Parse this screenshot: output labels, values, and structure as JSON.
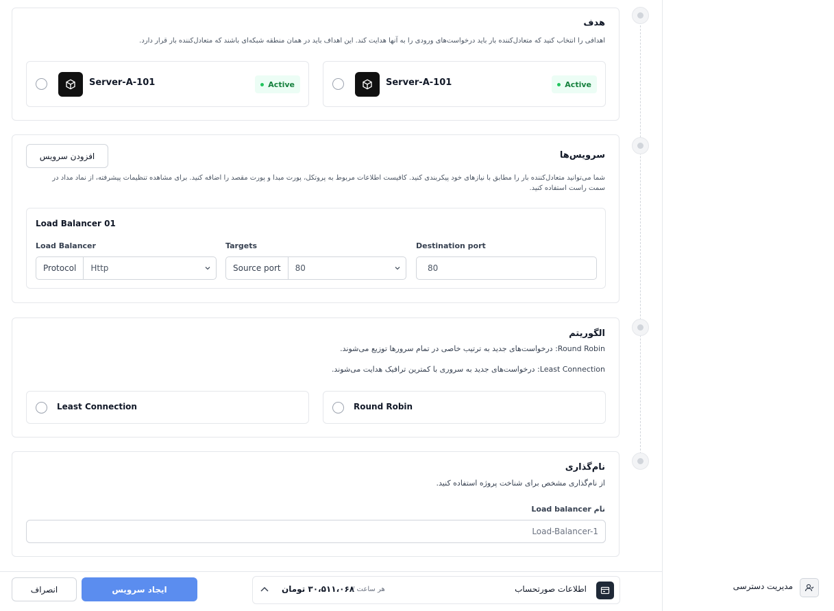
{
  "target_section": {
    "title": "هدف",
    "description": "اهدافی را انتخاب کنید که متعادل‌کننده بار باید درخواست‌های ورودی را به آنها هدایت کند. این اهداف باید در همان منطقه شبکه‌ای باشند که متعادل‌کننده بار قرار دارد.",
    "targets": [
      {
        "name": "Server-A-101",
        "status": "Active"
      },
      {
        "name": "Server-A-101",
        "status": "Active"
      }
    ]
  },
  "services_section": {
    "title": "سرویس‌ها",
    "add_button": "افزودن سرویس",
    "description": "شما می‌توانید متعادل‌کننده بار را مطابق با نیازهای خود پیکربندی کنید. کافیست اطلاعات مربوط به پروتکل، پورت مبدا و پورت مقصد را اضافه کنید. برای مشاهده تنظیمات پیشرفته، از نماد مداد در سمت راست استفاده کنید.",
    "service": {
      "title": "Load Balancer 01",
      "lb_label": "Load Balancer",
      "protocol_addon": "Protocol",
      "protocol_value": "Http",
      "targets_label": "Targets",
      "source_port_addon": "Source port",
      "source_port_value": "80",
      "dest_label": "Destination port",
      "dest_value": "80"
    }
  },
  "algorithm_section": {
    "title": "الگوریتم",
    "line1": "Round Robin: درخواست‌های جدید به ترتیب خاصی در تمام سرورها توزیع می‌شوند.",
    "line2": "Least Connection: درخواست‌های جدید به سروری با کمترین ترافیک هدایت می‌شوند.",
    "options": [
      "Round Robin",
      "Least Connection"
    ]
  },
  "naming_section": {
    "title": "نام‌گذاری",
    "description": "از نام‌گذاری مشخص برای شناخت پروژه استفاده کنید.",
    "field_label": "نام Load balancer",
    "field_value": "Load-Balancer-1"
  },
  "footer": {
    "cancel": "انصراف",
    "create": "ایجاد سرویس",
    "invoice_label": "اطلاعات صورتحساب",
    "per_hour": "هر ساعت /",
    "price": "۳۰،۵۱۱،۰۶۸ تومان"
  },
  "sidebar": {
    "access_label": "مدیریت دسترسی"
  }
}
